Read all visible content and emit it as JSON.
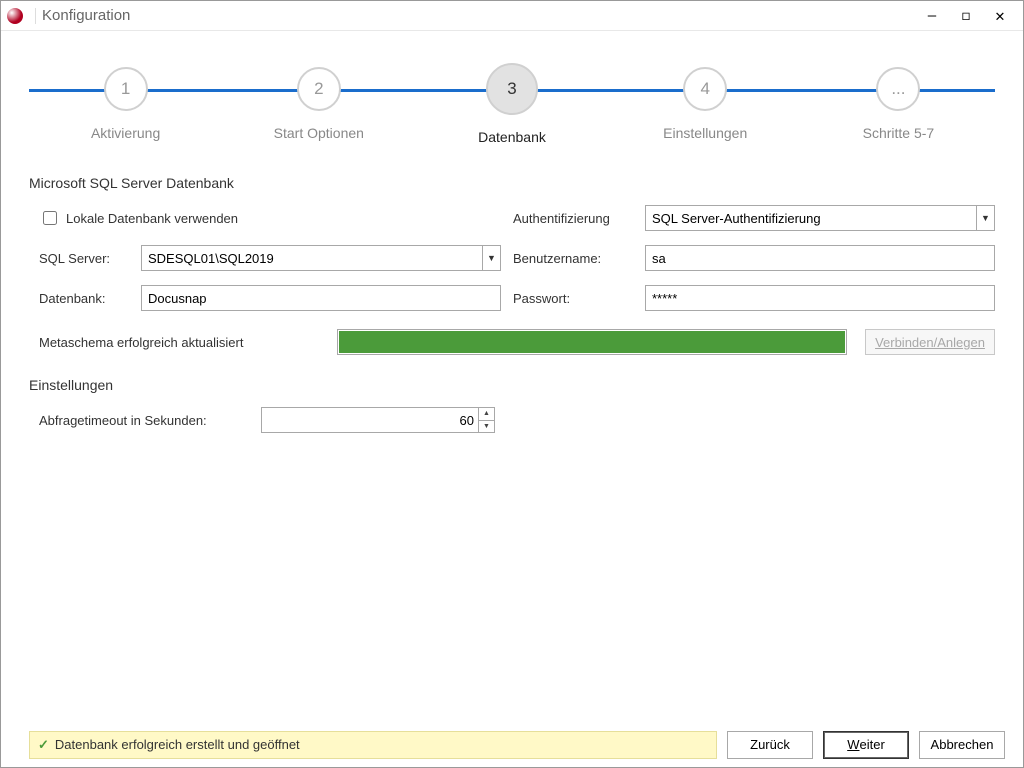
{
  "window": {
    "title": "Konfiguration"
  },
  "stepper": {
    "steps": [
      {
        "num": "1",
        "label": "Aktivierung"
      },
      {
        "num": "2",
        "label": "Start Optionen"
      },
      {
        "num": "3",
        "label": "Datenbank"
      },
      {
        "num": "4",
        "label": "Einstellungen"
      },
      {
        "num": "...",
        "label": "Schritte 5-7"
      }
    ]
  },
  "db_section": {
    "title": "Microsoft SQL Server Datenbank",
    "local_db_label": "Lokale Datenbank verwenden",
    "sql_server_label": "SQL Server:",
    "sql_server_value": "SDESQL01\\SQL2019",
    "database_label": "Datenbank:",
    "database_value": "Docusnap",
    "auth_label": "Authentifizierung",
    "auth_value": "SQL Server-Authentifizierung",
    "user_label": "Benutzername:",
    "user_value": "sa",
    "password_label": "Passwort:",
    "password_value": "*****",
    "status_text": "Metaschema erfolgreich aktualisiert",
    "connect_label": "Verbinden/Anlegen"
  },
  "settings_section": {
    "title": "Einstellungen",
    "timeout_label": "Abfragetimeout in Sekunden:",
    "timeout_value": "60"
  },
  "footer": {
    "status": "Datenbank erfolgreich erstellt und geöffnet",
    "back": "Zurück",
    "next_u": "W",
    "next_rest": "eiter",
    "cancel": "Abbrechen"
  }
}
